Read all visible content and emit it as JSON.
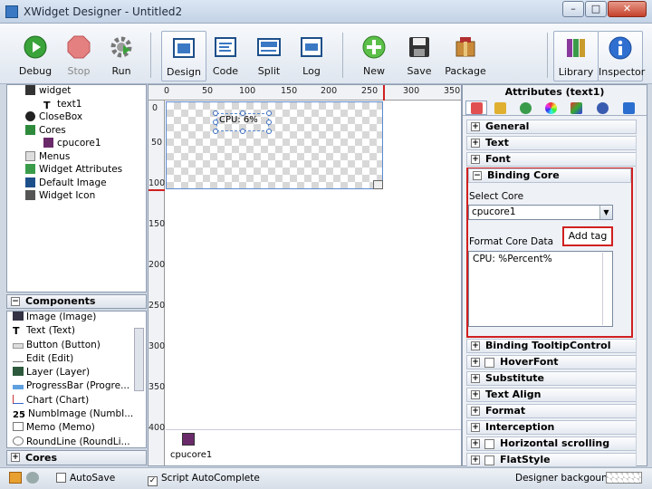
{
  "window": {
    "title": "XWidget Designer - Untitled2",
    "min_label": "–",
    "max_label": "□",
    "close_label": "✕"
  },
  "toolbar": {
    "debug": "Debug",
    "stop": "Stop",
    "run": "Run",
    "design": "Design",
    "code": "Code",
    "split": "Split",
    "log": "Log",
    "new": "New",
    "save": "Save",
    "package": "Package",
    "library": "Library",
    "inspector": "Inspector"
  },
  "tree": {
    "items": [
      "widget",
      "text1",
      "CloseBox",
      "Cores",
      "cpucore1",
      "Menus",
      "Widget Attributes",
      "Default Image",
      "Widget Icon"
    ]
  },
  "components": {
    "header": "Components",
    "items": [
      "Image (Image)",
      "Text (Text)",
      "Button (Button)",
      "Edit (Edit)",
      "Layer (Layer)",
      "ProgressBar (Progre...",
      "Chart (Chart)",
      "NumbImage (NumbI...",
      "Memo (Memo)",
      "RoundLine (RoundLi..."
    ]
  },
  "cores_panel": {
    "header": "Cores"
  },
  "canvas": {
    "h_ticks": [
      "0",
      "50",
      "100",
      "150",
      "200",
      "250",
      "300",
      "350"
    ],
    "v_ticks": [
      "0",
      "50",
      "100",
      "150",
      "200",
      "250",
      "300",
      "350",
      "400"
    ],
    "text1_content": "CPU: 6%",
    "core_label": "cpucore1"
  },
  "attributes": {
    "title": "Attributes (text1)",
    "sections_top": [
      "General",
      "Text",
      "Font"
    ],
    "binding_core": "Binding Core",
    "select_core_label": "Select Core",
    "select_core_value": "cpucore1",
    "add_tag": "Add tag",
    "format_label": "Format Core Data",
    "format_value": "CPU: %Percent%",
    "sections_bottom": [
      "Binding TooltipControl",
      "HoverFont",
      "Substitute",
      "Text Align",
      "Format",
      "Interception",
      "Horizontal scrolling",
      "FlatStyle"
    ]
  },
  "status": {
    "autosave": "AutoSave",
    "script_autocomplete": "Script AutoComplete",
    "designer_background": "Designer backgound"
  }
}
